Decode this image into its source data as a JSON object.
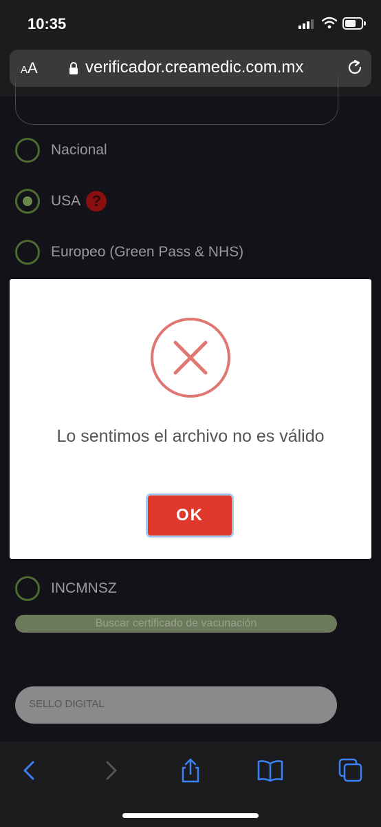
{
  "status_bar": {
    "time": "10:35"
  },
  "browser": {
    "aa_label_small": "A",
    "aa_label_large": "A",
    "url": "verificador.creamedic.com.mx"
  },
  "options": [
    {
      "label": "Nacional",
      "checked": false
    },
    {
      "label": "USA",
      "checked": true,
      "help": "?"
    },
    {
      "label": "Europeo (Green Pass & NHS)",
      "checked": false
    },
    {
      "label": "INCMNSZ",
      "checked": false
    }
  ],
  "search_button": "Buscar certificado de vacunación",
  "sello": {
    "placeholder": "SELLO DIGITAL"
  },
  "modal": {
    "message": "Lo sentimos el archivo no es válido",
    "ok_label": "OK",
    "icon_color": "#e07672"
  },
  "toolbar": {
    "icons": [
      "back-icon",
      "forward-icon",
      "share-icon",
      "bookmarks-icon",
      "tabs-icon"
    ],
    "accent": "#3a82f7"
  }
}
